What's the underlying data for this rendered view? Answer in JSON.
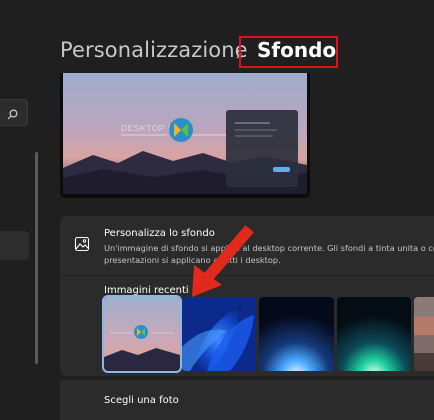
{
  "breadcrumb": {
    "parent": "Personalizzazione",
    "current": "Sfondo"
  },
  "preview": {
    "watermark": "DESKTOP  SOLU"
  },
  "background_section": {
    "title": "Personalizza lo sfondo",
    "description_line1": "Un'immagine di sfondo si applica al desktop corrente. Gli sfondi a tinta unita o co",
    "description_line2": "presentazioni si applicano a tutti i desktop.",
    "recent_images_label": "Immagini recenti",
    "recent_images": [
      {
        "name": "desktop-solution-wallpaper",
        "selected": true
      },
      {
        "name": "windows-11-bloom-blue"
      },
      {
        "name": "glow-blue"
      },
      {
        "name": "glow-green"
      },
      {
        "name": "landscape"
      }
    ]
  },
  "choose_photo": {
    "label": "Scegli una foto"
  },
  "colors": {
    "highlight_border": "#e0101a",
    "arrow": "#e22a1c",
    "accent": "#8db8e6"
  }
}
